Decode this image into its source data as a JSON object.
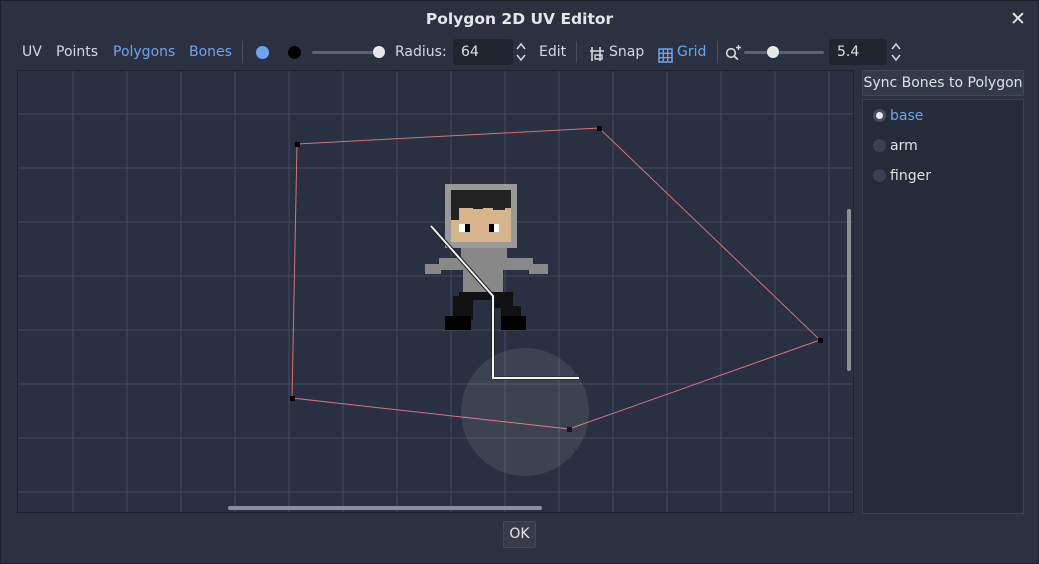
{
  "window": {
    "title": "Polygon 2D UV Editor",
    "close_icon": "close-icon",
    "ok_label": "OK"
  },
  "toolbar": {
    "modes": [
      {
        "label": "UV",
        "active": false
      },
      {
        "label": "Points",
        "active": false
      },
      {
        "label": "Polygons",
        "active": false
      },
      {
        "label": "Bones",
        "active": true
      }
    ],
    "paint_color": "#6aa6f0",
    "erase_color": "#000000",
    "brush_size_fraction": 1.0,
    "radius_label": "Radius:",
    "radius_value": "64",
    "edit_label": "Edit",
    "snap_label": "Snap",
    "snap_icon": "snap-icon",
    "grid_label": "Grid",
    "grid_icon": "grid-icon",
    "zoom_icon": "zoom-icon",
    "zoom_slider_fraction": 0.48,
    "zoom_value": "5.4",
    "accent_color": "#6aa6f0"
  },
  "bones_panel": {
    "sync_label": "Sync Bones to Polygon",
    "items": [
      {
        "label": "base",
        "selected": true
      },
      {
        "label": "arm",
        "selected": false
      },
      {
        "label": "finger",
        "selected": false
      }
    ]
  },
  "editor": {
    "polygon_color": "#e6707c",
    "bone_color": "#ffffff",
    "grid_color": "#4a5163"
  }
}
